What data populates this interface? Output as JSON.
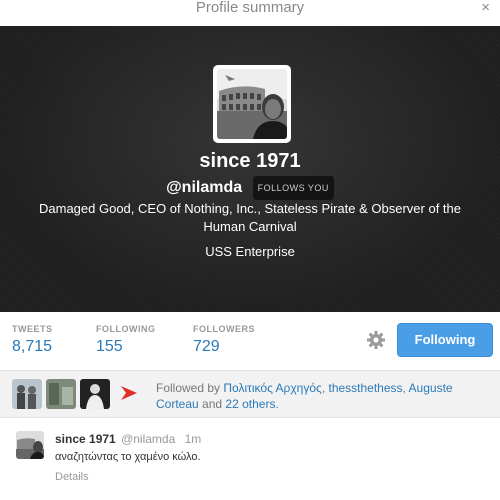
{
  "modal": {
    "title": "Profile summary",
    "close_glyph": "×"
  },
  "profile": {
    "display_name": "since 1971",
    "screen_name": "@nilamda",
    "follows_you_badge": "FOLLOWS YOU",
    "bio": "Damaged Good, CEO of Nothing, Inc., Stateless Pirate & Observer of the Human Carnival",
    "location": "USS Enterprise"
  },
  "stats": [
    {
      "label": "TWEETS",
      "value": "8,715"
    },
    {
      "label": "FOLLOWING",
      "value": "155"
    },
    {
      "label": "FOLLOWERS",
      "value": "729"
    }
  ],
  "actions": {
    "settings_icon": "gear-icon",
    "follow_button_label": "Following"
  },
  "followed_by": {
    "prefix": "Followed by",
    "users": [
      "Πολιτικός Αρχηγός",
      "thessthethess",
      "Auguste Corteau"
    ],
    "separator_1": ", ",
    "separator_2": ", ",
    "and_text": " and ",
    "others_link": "22 others",
    "suffix": "."
  },
  "tweet": {
    "name": "since 1971",
    "handle": "@nilamda",
    "time": "1m",
    "text": "αναζητώντας το χαμένο κώλο.",
    "details_link": "Details"
  },
  "colors": {
    "accent": "#4a9ee6",
    "link": "#2a7ab8",
    "hero_bg": "#1f1f1f",
    "arrow": "#e0302a"
  }
}
